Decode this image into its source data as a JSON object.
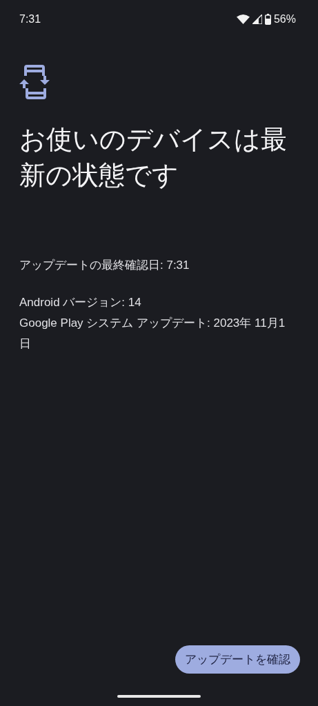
{
  "status_bar": {
    "time": "7:31",
    "battery": "56%"
  },
  "title": "お使いのデバイスは最新の状態です",
  "last_checked": "アップデートの最終確認日: 7:31",
  "info_lines": [
    "Android バージョン: 14",
    "Google Play システム アップデート: 2023年 11月1日"
  ],
  "button": "アップデートを確認"
}
